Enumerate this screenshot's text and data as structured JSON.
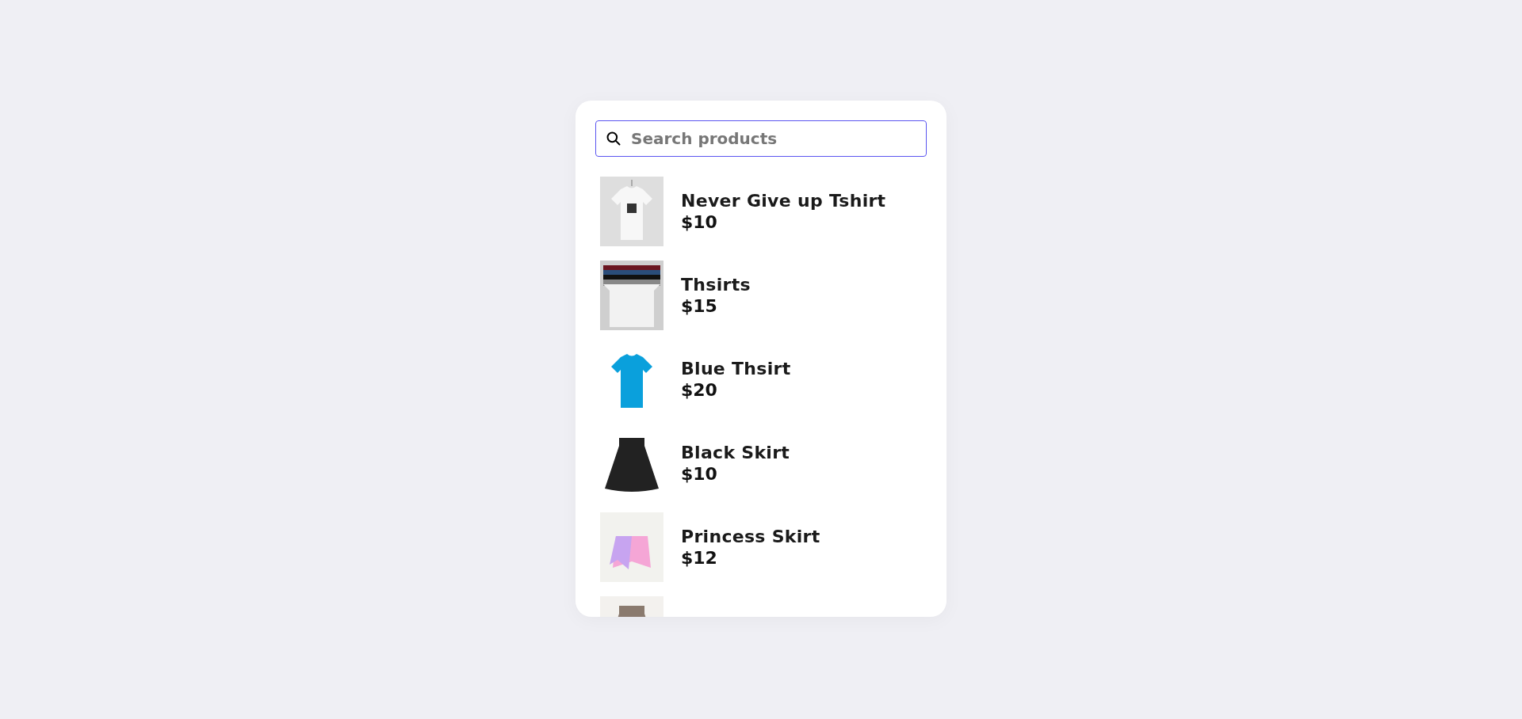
{
  "search": {
    "placeholder": "Search products"
  },
  "products": [
    {
      "name": "Never Give up Tshirt",
      "price": "$10",
      "kind": "picture"
    },
    {
      "name": "Thsirts",
      "price": "$15",
      "kind": "picture"
    },
    {
      "name": "Blue Thsirt",
      "price": "$20",
      "kind": "picture"
    },
    {
      "name": "Black Skirt",
      "price": "$10",
      "kind": "picture"
    },
    {
      "name": "Princess Skirt",
      "price": "$12",
      "kind": "picture"
    },
    {
      "kind": "picture"
    }
  ]
}
